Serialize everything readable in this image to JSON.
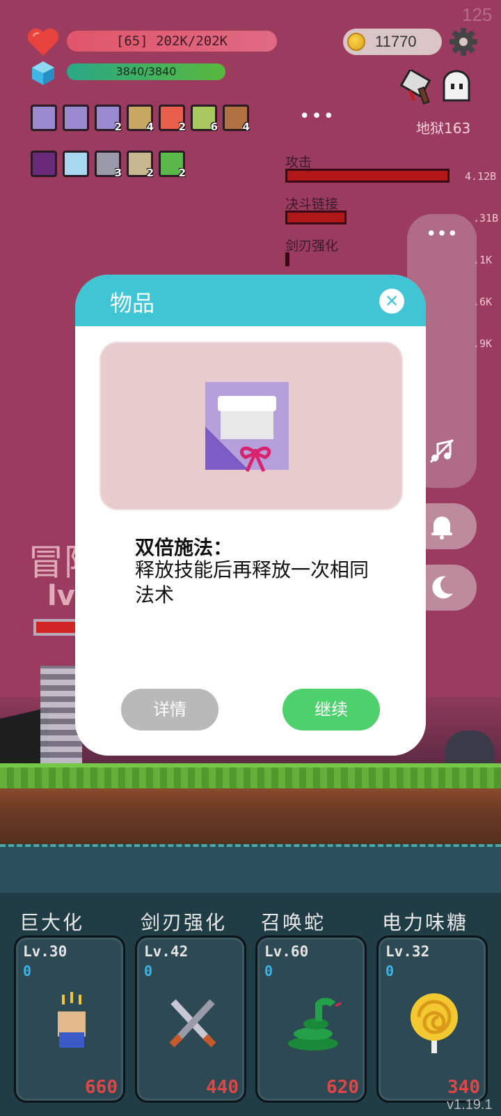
{
  "hud": {
    "fps": "125",
    "hp_text": "[65] 202K/202K",
    "mp_text": "3840/3840",
    "coins": "11770",
    "hell_level": "地狱163",
    "more": "•••"
  },
  "buffs_row1": [
    {
      "icon": "scroll-bow-icon",
      "count": ""
    },
    {
      "icon": "scroll-bow-icon",
      "count": ""
    },
    {
      "icon": "scroll-bow-icon",
      "count": "2"
    },
    {
      "icon": "tools-icon",
      "count": "4"
    },
    {
      "icon": "flame-icon",
      "count": "2"
    },
    {
      "icon": "bow-icon",
      "count": "6"
    },
    {
      "icon": "meat-icon",
      "count": "4"
    }
  ],
  "buffs_row2": [
    {
      "icon": "demon-icon",
      "count": ""
    },
    {
      "icon": "light-icon",
      "count": ""
    },
    {
      "icon": "blade-icon",
      "count": "3"
    },
    {
      "icon": "rune-icon",
      "count": "2"
    },
    {
      "icon": "check-icon",
      "count": "2"
    }
  ],
  "stats": [
    {
      "label": "攻击",
      "value": "4.12B"
    },
    {
      "label": "决斗链接",
      "value": ".31B"
    },
    {
      "label": "剑刃强化",
      "value": ".1K"
    },
    {
      "label": "",
      "value": ".6K"
    },
    {
      "label": "",
      "value": ".9K"
    }
  ],
  "background": {
    "adventure": "冒险",
    "lv": "lv."
  },
  "side_panel": {
    "more": "•••"
  },
  "modal": {
    "title": "物品",
    "close": "✕",
    "item_name": "双倍施法：",
    "item_desc": "释放技能后再释放一次相同法术",
    "details_label": "详情",
    "continue_label": "继续"
  },
  "skills": [
    {
      "name": "巨大化",
      "level": "Lv.30",
      "count": "0",
      "cost": "660",
      "icon": "fist-icon"
    },
    {
      "name": "剑刃强化",
      "level": "Lv.42",
      "count": "0",
      "cost": "440",
      "icon": "crossed-swords-icon"
    },
    {
      "name": "召唤蛇",
      "level": "Lv.60",
      "count": "0",
      "cost": "620",
      "icon": "snake-icon"
    },
    {
      "name": "电力味糖",
      "level": "Lv.32",
      "count": "0",
      "cost": "340",
      "icon": "lollipop-icon"
    }
  ],
  "version": "v1.19.1",
  "colors": {
    "background": "#9b3c5e",
    "modal_header": "#3fc5d4",
    "continue": "#4ed06c",
    "details": "#b9b9b9",
    "cost": "#e04646"
  }
}
